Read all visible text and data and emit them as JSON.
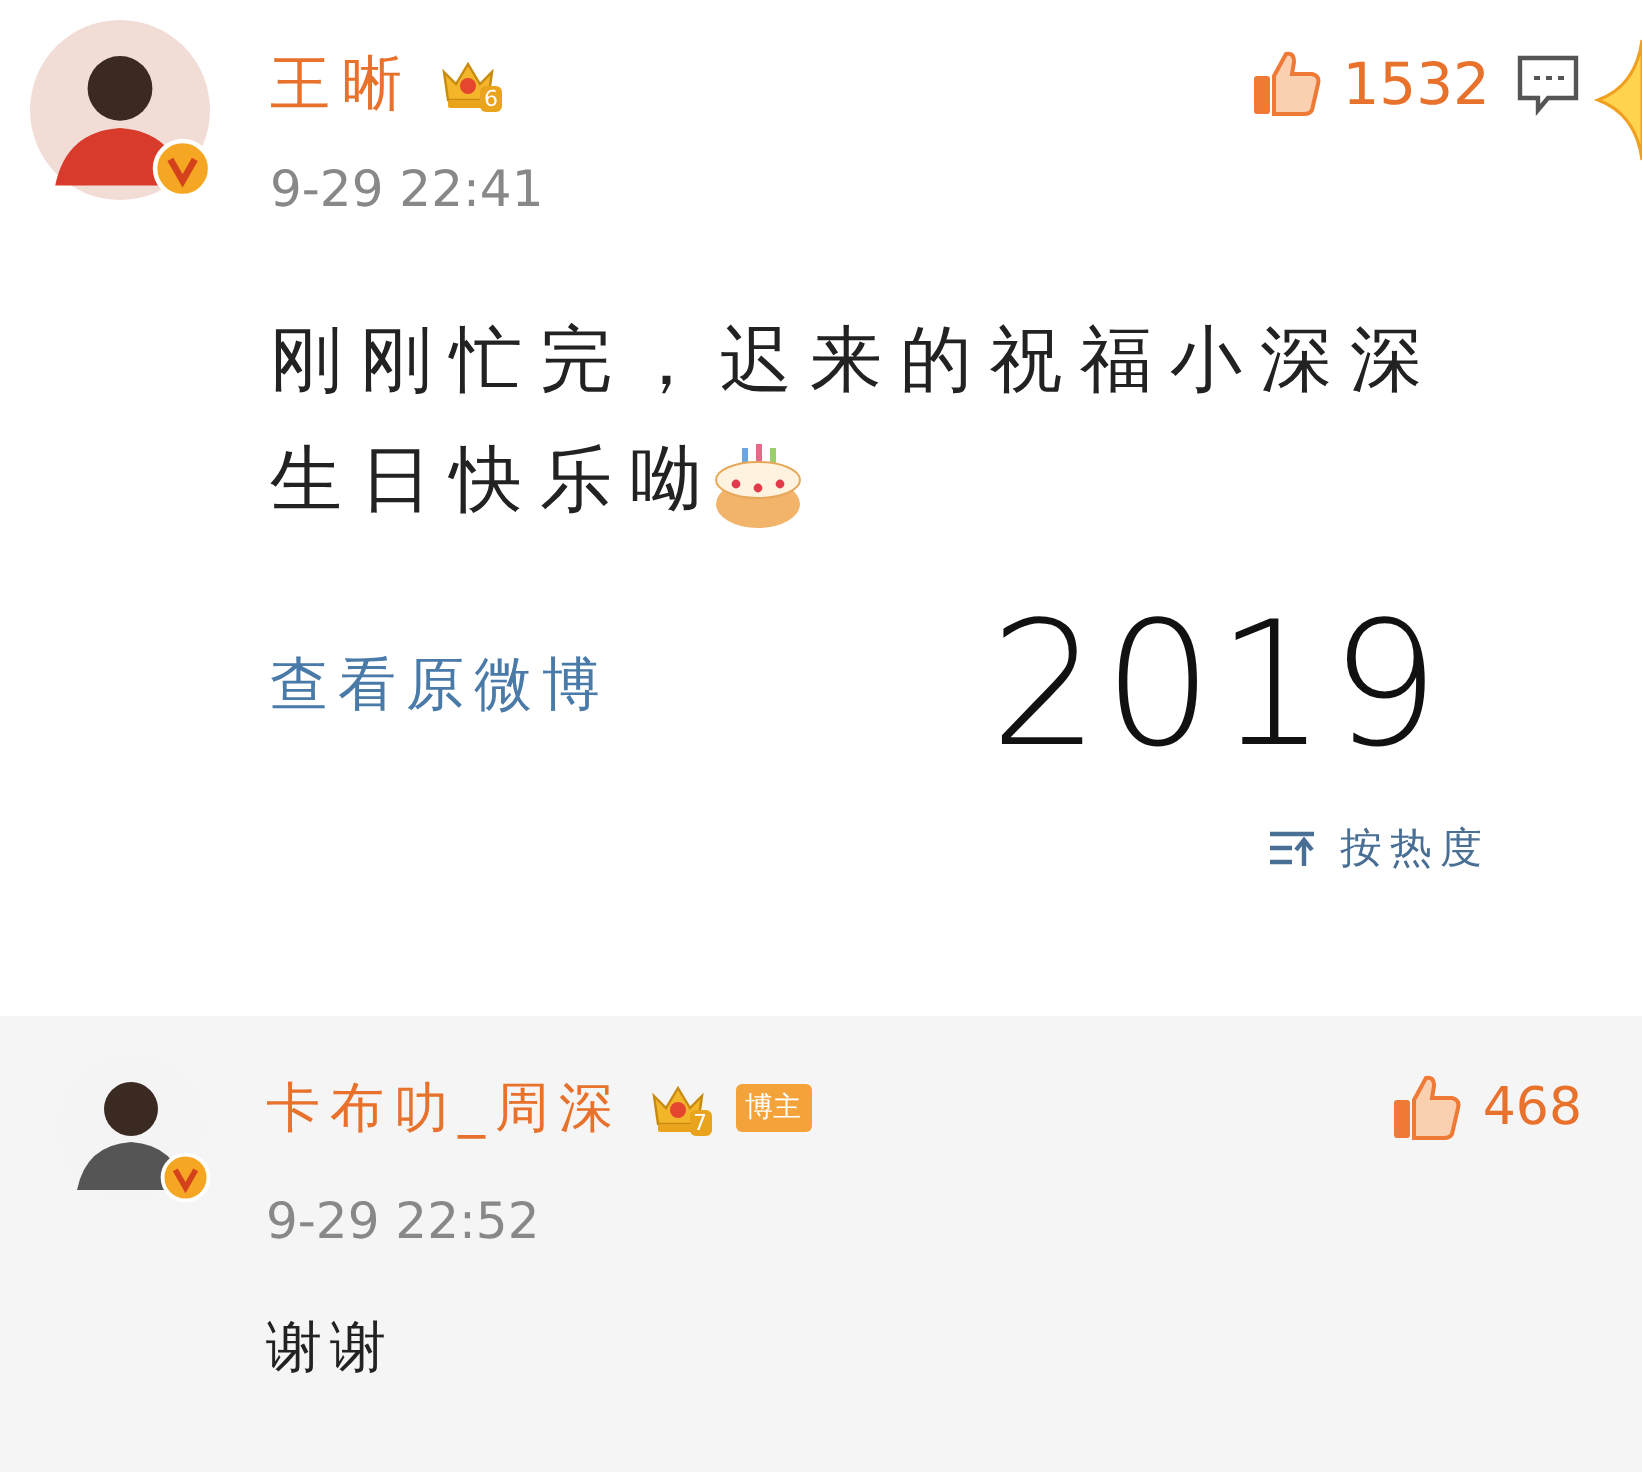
{
  "comment": {
    "author": "王晰",
    "level_badge": "6",
    "verified": true,
    "likes": "1532",
    "time": "9-29 22:41",
    "text_lines": [
      "刚刚忙完，迟来的祝福小深深",
      "生日快乐呦"
    ],
    "link": "查看原微博"
  },
  "annotation": "2019",
  "sort": {
    "label": "按热度"
  },
  "reply": {
    "author": "卡布叻_周深",
    "level_badge": "7",
    "badge": "博主",
    "verified": true,
    "likes": "468",
    "time": "9-29 22:52",
    "text": "谢谢"
  }
}
